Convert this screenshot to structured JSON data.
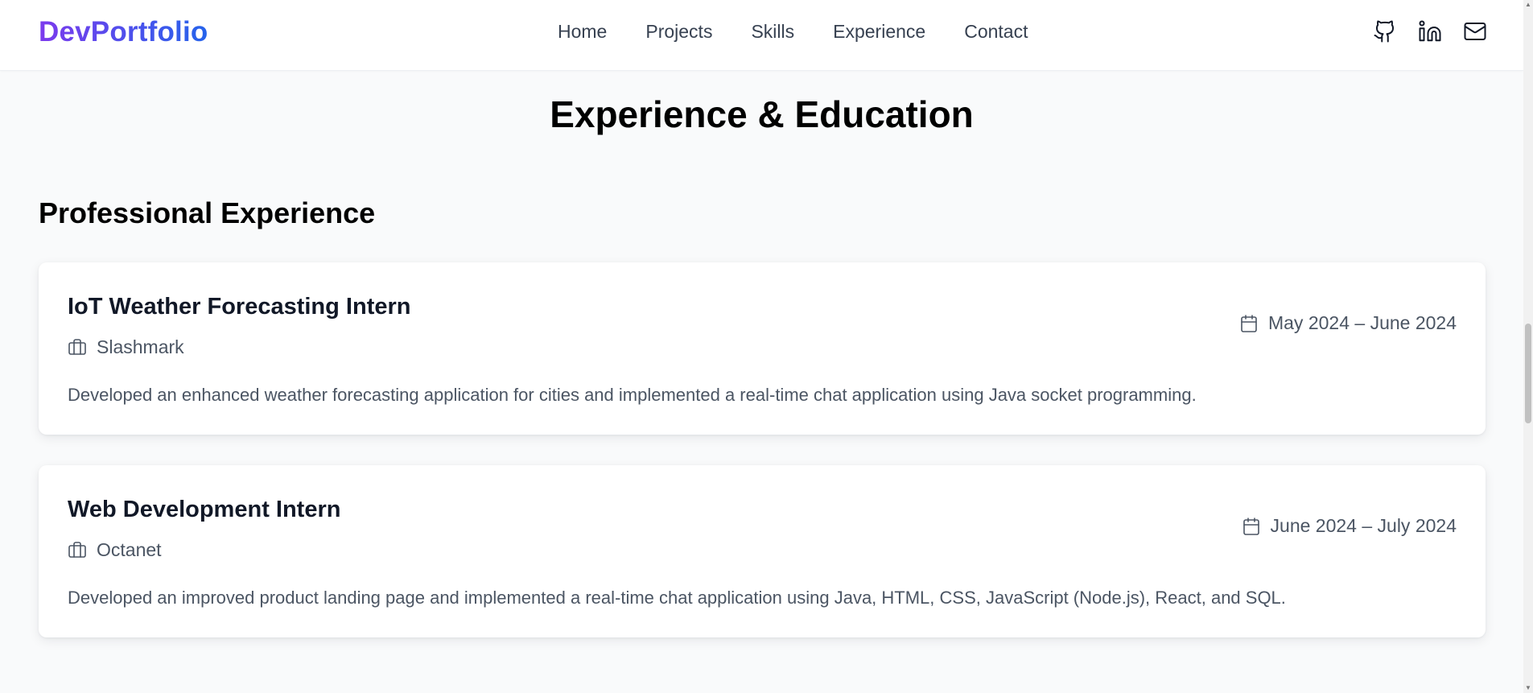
{
  "nav": {
    "logo": "DevPortfolio",
    "links": [
      {
        "label": "Home"
      },
      {
        "label": "Projects"
      },
      {
        "label": "Skills"
      },
      {
        "label": "Experience"
      },
      {
        "label": "Contact"
      }
    ],
    "icons": [
      "github-icon",
      "linkedin-icon",
      "mail-icon"
    ]
  },
  "section": {
    "title": "Experience & Education",
    "subheading": "Professional Experience"
  },
  "experience": [
    {
      "title": "IoT Weather Forecasting Intern",
      "company": "Slashmark",
      "dates": "May 2024 – June 2024",
      "description": "Developed an enhanced weather forecasting application for cities and implemented a real-time chat application using Java socket programming."
    },
    {
      "title": "Web Development Intern",
      "company": "Octanet",
      "dates": "June 2024 – July 2024",
      "description": "Developed an improved product landing page and implemented a real-time chat application using Java, HTML, CSS, JavaScript (Node.js), React, and SQL."
    }
  ],
  "colors": {
    "logo_gradient_start": "#7c3aed",
    "logo_gradient_end": "#2563eb",
    "background": "#f9fafb",
    "card": "#ffffff",
    "muted_text": "#4b5563"
  }
}
